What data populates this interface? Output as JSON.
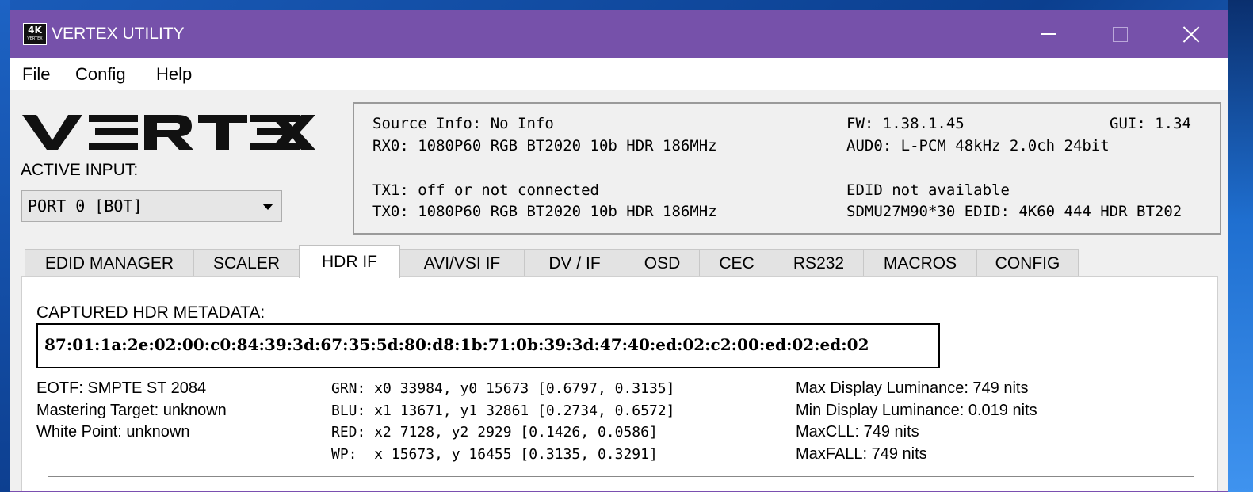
{
  "window": {
    "title": "VERTEX UTILITY",
    "icon_label": "4K",
    "icon_sub": "VERTEX"
  },
  "menu": {
    "file": "File",
    "config": "Config",
    "help": "Help"
  },
  "brand": {
    "logo_text": "VERTEX"
  },
  "active_input": {
    "label": "ACTIVE INPUT:",
    "selected": "PORT 0 [BOT]"
  },
  "info": {
    "source_info": "Source Info: No Info",
    "rx0": "RX0: 1080P60 RGB BT2020 10b HDR 186MHz",
    "tx1": "TX1: off or not connected",
    "tx0": "TX0: 1080P60 RGB BT2020 10b HDR 186MHz",
    "fw": "FW: 1.38.1.45",
    "gui": "GUI: 1.34",
    "aud0": "AUD0: L-PCM 48kHz 2.0ch 24bit",
    "edid_status": "EDID not available",
    "edid_sink": "SDMU27M90*30 EDID: 4K60 444 HDR BT202"
  },
  "tabs": [
    "EDID MANAGER",
    "SCALER",
    "HDR IF",
    "AVI/VSI IF",
    "DV / IF",
    "OSD",
    "CEC",
    "RS232",
    "MACROS",
    "CONFIG"
  ],
  "active_tab": "HDR IF",
  "hdr": {
    "captured_label": "CAPTURED HDR METADATA:",
    "hex": "87:01:1a:2e:02:00:c0:84:39:3d:67:35:5d:80:d8:1b:71:0b:39:3d:47:40:ed:02:c2:00:ed:02:ed:02",
    "eotf": "EOTF: SMPTE ST 2084",
    "mastering_target": "Mastering Target: unknown",
    "white_point": "White Point: unknown",
    "grn": "GRN: x0 33984, y0 15673 [0.6797, 0.3135]",
    "blu": "BLU: x1 13671, y1 32861 [0.2734, 0.6572]",
    "red": "RED: x2 7128, y2 2929 [0.1426, 0.0586]",
    "wp": "WP:  x 15673, y 16455 [0.3135, 0.3291]",
    "max_display_lum": "Max Display Luminance: 749 nits",
    "min_display_lum": "Min Display Luminance: 0.019 nits",
    "maxcll": "MaxCLL: 749 nits",
    "maxfall": "MaxFALL: 749 nits"
  },
  "colors": {
    "titlebar": "#7651aa",
    "window_bg": "#f0f0f0",
    "panel_bg": "#ffffff"
  }
}
